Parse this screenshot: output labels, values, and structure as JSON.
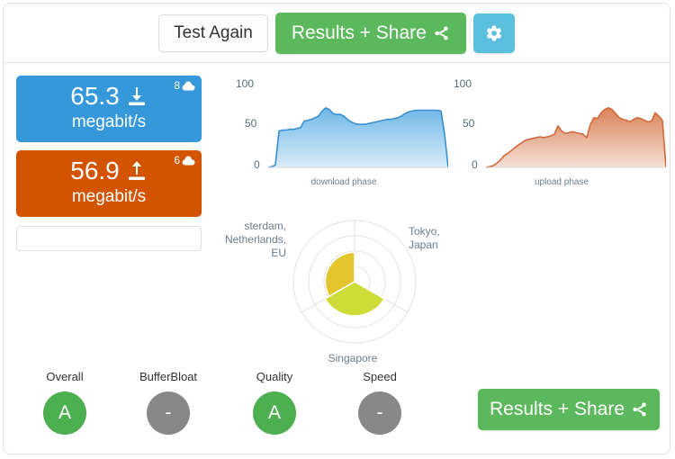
{
  "toolbar": {
    "test_again_label": "Test Again",
    "results_share_label": "Results + Share",
    "share_icon": "share-icon",
    "gear_icon": "gear-icon"
  },
  "download": {
    "value": "65.3",
    "unit": "megabit/s",
    "badge_count": "8",
    "badge_icon": "cloud-icon",
    "direction_icon": "download-arrow-icon",
    "color": "#3498db"
  },
  "upload": {
    "value": "56.9",
    "unit": "megabit/s",
    "badge_count": "6",
    "badge_icon": "cloud-icon",
    "direction_icon": "upload-arrow-icon",
    "color": "#d35400"
  },
  "share_url": {
    "value": "",
    "placeholder": ""
  },
  "polar": {
    "labels": {
      "amsterdam": "sterdam, Netherlands, EU",
      "tokyo": "Tokyo, Japan",
      "singapore": "Singapore"
    },
    "colors": {
      "amsterdam": "#e3c62e",
      "singapore": "#cddc39",
      "tokyo": "#ffffff"
    }
  },
  "grades": [
    {
      "label": "Overall",
      "value": "A",
      "color": "#4caf50"
    },
    {
      "label": "BufferBloat",
      "value": "-",
      "color": "#888888"
    },
    {
      "label": "Quality",
      "value": "A",
      "color": "#4caf50"
    },
    {
      "label": "Speed",
      "value": "-",
      "color": "#888888"
    }
  ],
  "bottom": {
    "results_share_label": "Results + Share",
    "share_icon": "share-icon"
  },
  "chart_data": [
    {
      "type": "area",
      "title": "download phase",
      "xlabel": "download phase",
      "ylabel": "",
      "ylim": [
        0,
        100
      ],
      "yticks": [
        0,
        50,
        100
      ],
      "ytick_labels": [
        "0",
        "50",
        "100"
      ],
      "grid": false,
      "legend": "none",
      "color": "#3a8fd0",
      "x": [
        0,
        2,
        4,
        6,
        8,
        10,
        12,
        14,
        16,
        18,
        20,
        22,
        24,
        26,
        28,
        30,
        32,
        34,
        36,
        38,
        40,
        42,
        44,
        46,
        48,
        50,
        52,
        54,
        56,
        58,
        60,
        62,
        64,
        66,
        68,
        70,
        72,
        74,
        76,
        78,
        80,
        82,
        84,
        86,
        88,
        90,
        92,
        94,
        96,
        98,
        100
      ],
      "values": [
        0,
        1,
        3,
        44,
        45,
        45,
        46,
        46,
        47,
        48,
        56,
        57,
        58,
        60,
        62,
        68,
        72,
        70,
        65,
        64,
        64,
        62,
        58,
        55,
        53,
        52,
        52,
        52,
        53,
        54,
        55,
        56,
        57,
        58,
        58,
        59,
        60,
        62,
        65,
        67,
        68,
        69,
        69,
        69,
        69,
        69,
        69,
        69,
        68,
        40,
        0
      ]
    },
    {
      "type": "area",
      "title": "upload phase",
      "xlabel": "upload phase",
      "ylabel": "",
      "ylim": [
        0,
        100
      ],
      "yticks": [
        0,
        50,
        100
      ],
      "ytick_labels": [
        "0",
        "50",
        "100"
      ],
      "grid": false,
      "legend": "none",
      "color": "#d2683a",
      "x": [
        0,
        2,
        4,
        6,
        8,
        10,
        12,
        14,
        16,
        18,
        20,
        22,
        24,
        26,
        28,
        30,
        32,
        34,
        36,
        38,
        40,
        42,
        44,
        46,
        48,
        50,
        52,
        54,
        56,
        58,
        60,
        62,
        64,
        66,
        68,
        70,
        72,
        74,
        76,
        78,
        80,
        82,
        84,
        86,
        88,
        90,
        92,
        94,
        96,
        98,
        100
      ],
      "values": [
        0,
        1,
        2,
        5,
        9,
        14,
        17,
        20,
        24,
        27,
        30,
        33,
        34,
        35,
        36,
        37,
        36,
        37,
        38,
        40,
        50,
        44,
        41,
        42,
        43,
        42,
        41,
        40,
        36,
        52,
        60,
        59,
        66,
        70,
        72,
        70,
        65,
        60,
        58,
        57,
        55,
        58,
        60,
        59,
        57,
        55,
        56,
        66,
        62,
        57,
        0
      ]
    },
    {
      "type": "pie",
      "title": "server locations",
      "labels": [
        "sterdam, Netherlands, EU",
        "Tokyo, Japan",
        "Singapore"
      ],
      "values": [
        1,
        0,
        1
      ],
      "radii": [
        0.48,
        0.0,
        0.56
      ],
      "colors": [
        "#e3c62e",
        "#ffffff",
        "#cddc39"
      ],
      "legend": "around",
      "rings": 4
    }
  ]
}
